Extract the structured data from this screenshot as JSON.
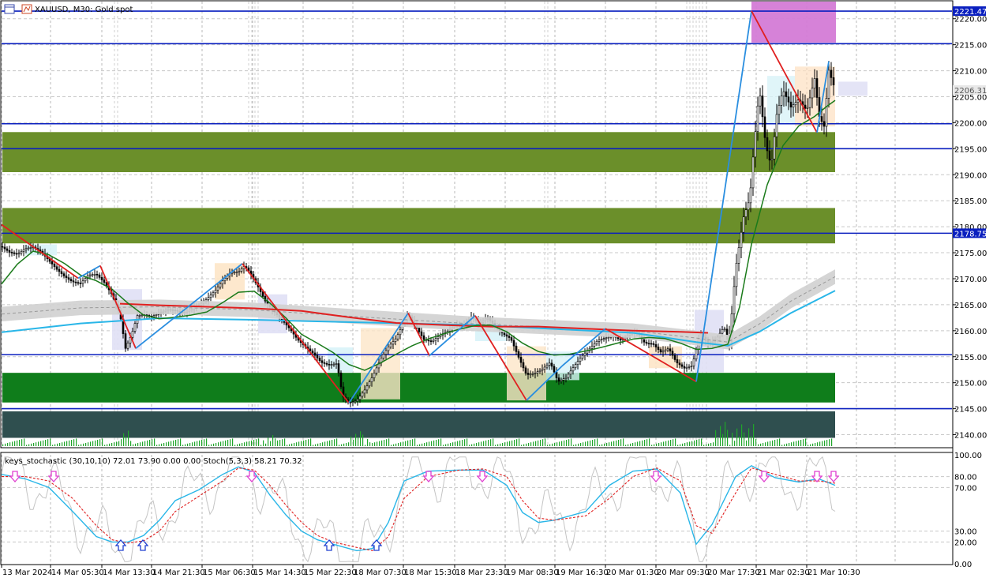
{
  "header": {
    "symbol_title": "XAUUSD, M30:  Gold spot"
  },
  "colors": {
    "line_blue": "#0a1fbf",
    "support_green": "#6b8f2a",
    "dark_green": "#0f7d1b",
    "slate": "#2f4f4f",
    "magenta_box": "#d47bd6",
    "zigzag_red": "#e02020",
    "zigzag_blue": "#2a8ee0",
    "ma_green": "#1a7a1a",
    "ma_red": "#e02020",
    "ma_cyan": "#29b6e8",
    "stoch_main": "#29b6e8",
    "stoch_signal": "#e02020"
  },
  "chart_data": [
    {
      "type": "line",
      "title": "XAUUSD, M30:  Gold spot",
      "price_axis_labels": [
        "2220.00",
        "2215.00",
        "2210.00",
        "2205.00",
        "2200.00",
        "2195.00",
        "2190.00",
        "2185.00",
        "2180.00",
        "2175.00",
        "2170.00",
        "2165.00",
        "2160.00",
        "2155.00",
        "2150.00",
        "2145.00",
        "2140.00"
      ],
      "price_marker_labels": [
        {
          "text": "2221.47",
          "price": 2221.47,
          "style": "blue"
        },
        {
          "text": "2206.31",
          "price": 2206.31,
          "style": "gray"
        },
        {
          "text": "2178.75",
          "price": 2178.75,
          "style": "blue"
        }
      ],
      "time_labels": [
        "13 Mar 2024",
        "14 Mar 05:30",
        "14 Mar 13:30",
        "14 Mar 21:30",
        "15 Mar 06:30",
        "15 Mar 14:30",
        "15 Mar 22:30",
        "18 Mar 07:30",
        "18 Mar 15:30",
        "18 Mar 23:30",
        "19 Mar 08:30",
        "19 Mar 16:30",
        "20 Mar 01:30",
        "20 Mar 09:30",
        "20 Mar 17:30",
        "21 Mar 02:30",
        "21 Mar 10:30"
      ],
      "ylim": [
        2137.5,
        2223.3
      ],
      "horizontal_levels": [
        2221.47,
        2215.2,
        2199.8,
        2195.0,
        2178.75,
        2155.4,
        2145.0
      ],
      "zones": [
        {
          "from": 2190.5,
          "to": 2198.2,
          "color": "support_green"
        },
        {
          "from": 2176.8,
          "to": 2183.6,
          "color": "support_green"
        },
        {
          "from": 2146.2,
          "to": 2151.9,
          "color": "dark_green"
        },
        {
          "from": 2144.5,
          "to": 2139.4,
          "color": "slate"
        }
      ],
      "series": [
        {
          "key": "price",
          "x": [
            0,
            10,
            20,
            30,
            40,
            50,
            60,
            70,
            80,
            90,
            100,
            110,
            120,
            130,
            140,
            150,
            157,
            165,
            172,
            180,
            190,
            200,
            210,
            220,
            230,
            240,
            250,
            260,
            270,
            280,
            290,
            300,
            308,
            315,
            325,
            335,
            345,
            355,
            365,
            375,
            385,
            395,
            405,
            415,
            425,
            432,
            440,
            450,
            460,
            470,
            480,
            490,
            500,
            508,
            515,
            525,
            535,
            545,
            555,
            565,
            575,
            585,
            595,
            605,
            615,
            625,
            635,
            645,
            655,
            665,
            675,
            685,
            695,
            705,
            715,
            725,
            735,
            745,
            755,
            765,
            775,
            785,
            795,
            805,
            815,
            825,
            835,
            845,
            855,
            865,
            875,
            885,
            895,
            905,
            915,
            922,
            930,
            940,
            948,
            952,
            960,
            968,
            975,
            982,
            990,
            1000,
            1010,
            1020,
            1030,
            1036,
            1042,
            1048,
            1056
          ],
          "values": [
            2176.2,
            2175.1,
            2174.7,
            2175.8,
            2176.1,
            2175.2,
            2173.5,
            2171.8,
            2170.4,
            2169.4,
            2169.1,
            2170.7,
            2170.9,
            2169.3,
            2166.9,
            2163.2,
            2156.6,
            2159.4,
            2162.9,
            2163.1,
            2162.7,
            2163.4,
            2164.1,
            2163.9,
            2163.4,
            2164.1,
            2164.9,
            2166.1,
            2167.6,
            2169.6,
            2171.2,
            2171.3,
            2172.5,
            2171.1,
            2168.4,
            2165.4,
            2163.7,
            2162.1,
            2160.4,
            2158.3,
            2156.9,
            2155.6,
            2153.9,
            2153.4,
            2153.7,
            2147.4,
            2146.1,
            2146.6,
            2148.6,
            2151.2,
            2154.5,
            2156.9,
            2158.6,
            2161.2,
            2163.1,
            2160.8,
            2158.3,
            2157.9,
            2159.1,
            2159.9,
            2161.2,
            2160.9,
            2162.7,
            2161.4,
            2162.5,
            2161.0,
            2159.4,
            2158.5,
            2154.9,
            2151.5,
            2151.8,
            2152.6,
            2153.9,
            2150.2,
            2151.0,
            2153.1,
            2155.1,
            2156.6,
            2158.1,
            2158.6,
            2159.0,
            2158.1,
            2159.4,
            2159.7,
            2157.6,
            2157.5,
            2155.9,
            2156.6,
            2153.9,
            2152.8,
            2153.3,
            2159.6,
            2157.5,
            2158.3,
            2160.7,
            2158.0,
            2172.0,
            2181.9,
            2185.5,
            2193.4,
            2206.5,
            2195.8,
            2191.6,
            2201.6,
            2206.3,
            2203.0,
            2204.5,
            2202.3,
            2208.5,
            2201.2,
            2199.3,
            2210.1,
            2206.3
          ]
        },
        {
          "key": "ma_fast",
          "x": [
            0,
            20,
            40,
            60,
            80,
            100,
            120,
            140,
            160,
            180,
            200,
            220,
            240,
            260,
            280,
            300,
            320,
            340,
            360,
            380,
            400,
            420,
            440,
            460,
            480,
            500,
            520,
            540,
            560,
            580,
            600,
            620,
            640,
            660,
            680,
            700,
            720,
            740,
            760,
            780,
            800,
            820,
            840,
            860,
            880,
            900,
            920,
            935,
            950,
            970,
            990,
            1010,
            1030,
            1045,
            1056
          ],
          "values": [
            2169.0,
            2172.8,
            2175.3,
            2174.6,
            2172.9,
            2170.7,
            2169.6,
            2168.0,
            2165.3,
            2163.0,
            2162.3,
            2162.6,
            2163.0,
            2163.6,
            2165.4,
            2167.4,
            2167.6,
            2165.3,
            2162.5,
            2159.3,
            2157.6,
            2155.8,
            2153.5,
            2152.4,
            2153.8,
            2155.5,
            2157.1,
            2158.4,
            2159.4,
            2160.3,
            2161.0,
            2161.1,
            2159.8,
            2157.6,
            2156.0,
            2155.3,
            2155.5,
            2156.1,
            2156.8,
            2157.6,
            2158.4,
            2158.7,
            2158.5,
            2157.6,
            2156.4,
            2156.6,
            2157.4,
            2164.6,
            2176.6,
            2188.1,
            2195.6,
            2199.4,
            2201.2,
            2203.1,
            2204.3
          ]
        },
        {
          "key": "ma_red",
          "x": [
            150,
            200,
            260,
            320,
            380,
            440,
            500,
            560,
            620,
            680,
            740,
            800,
            860,
            895
          ],
          "values": [
            2165.2,
            2164.9,
            2164.6,
            2164.3,
            2163.8,
            2162.6,
            2161.5,
            2161.1,
            2160.8,
            2160.8,
            2160.4,
            2160.0,
            2159.8,
            2159.6
          ]
        },
        {
          "key": "ma_cyan",
          "x": [
            0,
            100,
            200,
            320,
            400,
            600,
            800,
            880,
            920,
            960,
            1000,
            1056
          ],
          "values": [
            2159.7,
            2161.4,
            2162.4,
            2162.1,
            2161.8,
            2161.1,
            2159.6,
            2157.8,
            2157.1,
            2159.8,
            2163.4,
            2167.7
          ]
        },
        {
          "key": "zigzag",
          "x": [
            0,
            97,
            125,
            170,
            305,
            440,
            515,
            542,
            600,
            665,
            710,
            765,
            880,
            950,
            1033,
            1048
          ],
          "values": [
            2180.4,
            2170.1,
            2172.5,
            2156.6,
            2172.9,
            2146.1,
            2163.4,
            2155.2,
            2162.9,
            2146.6,
            2153.2,
            2160.4,
            2150.2,
            2221.5,
            2198.1,
            2211.8
          ]
        }
      ]
    },
    {
      "type": "line",
      "title": "keys_stochastic (30,10,10) 72.01 73.90 0.00 0.00 Stoch(5,3,3) 58.21 70.32",
      "y_axis_labels": [
        "100.00",
        "80.00",
        "70.00",
        "30.00",
        "20.00",
        "0.00"
      ],
      "ylim": [
        0,
        100
      ],
      "series": [
        {
          "key": "stoch_main",
          "x": [
            0,
            30,
            60,
            90,
            120,
            140,
            160,
            180,
            200,
            220,
            250,
            280,
            300,
            320,
            340,
            360,
            380,
            400,
            420,
            450,
            470,
            490,
            510,
            540,
            580,
            610,
            640,
            660,
            680,
            700,
            740,
            770,
            800,
            830,
            860,
            880,
            900,
            930,
            950,
            980,
            1010,
            1035,
            1056
          ],
          "values": [
            82,
            78,
            70,
            48,
            25,
            20,
            20,
            26,
            40,
            58,
            68,
            82,
            89,
            84,
            63,
            45,
            30,
            22,
            18,
            12,
            14,
            38,
            76,
            85,
            86,
            86,
            72,
            47,
            38,
            40,
            48,
            72,
            85,
            87,
            65,
            18,
            36,
            80,
            90,
            79,
            75,
            78,
            72
          ]
        },
        {
          "key": "stoch_signal",
          "x": [
            0,
            30,
            60,
            90,
            120,
            140,
            160,
            180,
            200,
            220,
            250,
            280,
            300,
            320,
            340,
            360,
            380,
            400,
            420,
            450,
            470,
            490,
            510,
            540,
            580,
            610,
            640,
            660,
            680,
            700,
            740,
            770,
            800,
            830,
            860,
            880,
            900,
            930,
            950,
            980,
            1010,
            1035,
            1056
          ],
          "values": [
            80,
            80,
            76,
            60,
            35,
            22,
            19,
            21,
            30,
            48,
            62,
            76,
            88,
            86,
            72,
            54,
            38,
            26,
            20,
            15,
            12,
            25,
            60,
            80,
            86,
            87,
            80,
            58,
            42,
            40,
            44,
            60,
            80,
            88,
            76,
            35,
            28,
            65,
            88,
            82,
            76,
            76,
            74
          ]
        }
      ],
      "down_arrows_x": [
        17,
        66,
        317,
        541,
        609,
        829,
        966,
        1033,
        1054
      ],
      "up_arrows_x": [
        151,
        179,
        415,
        475
      ]
    }
  ]
}
